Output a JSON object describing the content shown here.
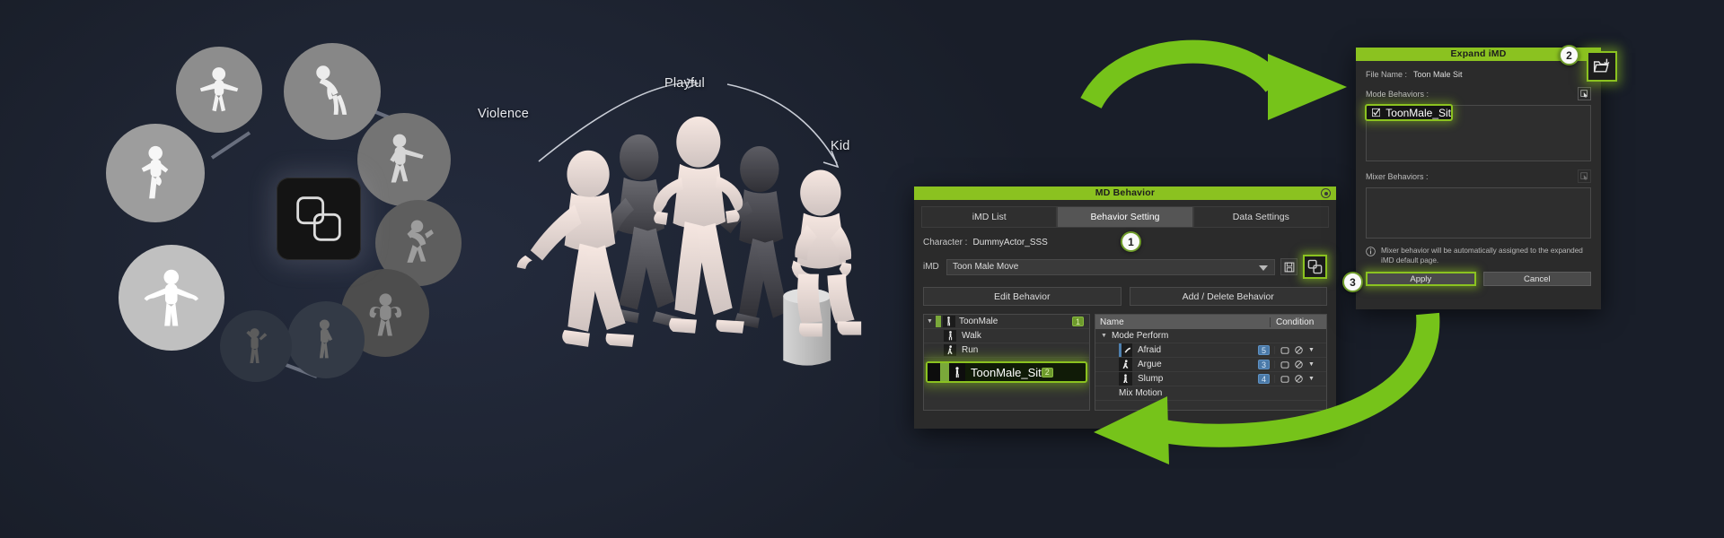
{
  "scene": {
    "background_color": "#191e29",
    "accent_color": "#8bc220",
    "group_labels": {
      "left": "Violence",
      "top": "Playful",
      "right": "Kid"
    }
  },
  "wheel": {
    "center_icon": "expand-imd-icon",
    "nodes": [
      {
        "name": "pose-cheer",
        "icon": "figure-arms-out-icon"
      },
      {
        "name": "pose-bow",
        "icon": "figure-bowing-icon"
      },
      {
        "name": "pose-point",
        "icon": "figure-pointing-icon"
      },
      {
        "name": "pose-sneak",
        "icon": "figure-sneaking-icon"
      },
      {
        "name": "pose-flex",
        "icon": "figure-flexing-icon"
      },
      {
        "name": "pose-drink",
        "icon": "figure-drinking-icon"
      },
      {
        "name": "pose-pose",
        "icon": "figure-posing-icon"
      },
      {
        "name": "pose-shrug",
        "icon": "figure-shrug-icon"
      },
      {
        "name": "pose-kick",
        "icon": "figure-kick-icon"
      }
    ]
  },
  "md_behavior": {
    "title": "MD Behavior",
    "close_icon": "close-icon",
    "tabs": [
      {
        "label": "iMD List",
        "active": false
      },
      {
        "label": "Behavior Setting",
        "active": true
      },
      {
        "label": "Data Settings",
        "active": false
      }
    ],
    "character_label": "Character :",
    "character_value": "DummyActor_SSS",
    "imd_label": "iMD",
    "imd_value": "Toon Male Move",
    "save_icon": "save-icon",
    "expand_icon": "expand-imd-icon",
    "buttons": {
      "edit": "Edit Behavior",
      "add_delete": "Add / Delete Behavior"
    },
    "behavior_tree": [
      {
        "label": "ToonMale",
        "badge": "1",
        "level": 0,
        "expanded": true,
        "selected": false
      },
      {
        "label": "Walk",
        "badge": "",
        "level": 1,
        "selected": false
      },
      {
        "label": "Run",
        "badge": "",
        "level": 1,
        "selected": false
      },
      {
        "label": "ToonMale_Sit",
        "badge": "2",
        "level": 1,
        "selected": true
      }
    ],
    "motion_table": {
      "columns": [
        "Name",
        "Condition"
      ],
      "group": "Mode Perform",
      "rows": [
        {
          "name": "Afraid",
          "count": "5",
          "icon": "motion-icon"
        },
        {
          "name": "Argue",
          "count": "3",
          "icon": "motion-icon"
        },
        {
          "name": "Slump",
          "count": "4",
          "icon": "motion-icon"
        }
      ],
      "footer_group": "Mix Motion"
    }
  },
  "expand_imd": {
    "title": "Expand iMD",
    "close_icon": "close-icon",
    "file_name_label": "File Name :",
    "file_name_value": "Toon Male Sit",
    "mode_behaviors_label": "Mode Behaviors :",
    "mode_pick_icon": "pick-cursor-icon",
    "mode_items": [
      {
        "label": "ToonMale_Sit",
        "checked": true,
        "highlighted": true
      }
    ],
    "mixer_behaviors_label": "Mixer Behaviors :",
    "mixer_pick_icon": "pick-cursor-icon",
    "mixer_items": [],
    "note_icon": "info-icon",
    "note": "Mixer behavior will be automatically assigned to the expanded iMD default page.",
    "import_icon": "import-folder-icon",
    "apply_label": "Apply",
    "cancel_label": "Cancel"
  },
  "steps": [
    {
      "number": "1",
      "target": "expand-imd-toolbar-button"
    },
    {
      "number": "2",
      "target": "import-folder-button"
    },
    {
      "number": "3",
      "target": "apply-button"
    }
  ]
}
